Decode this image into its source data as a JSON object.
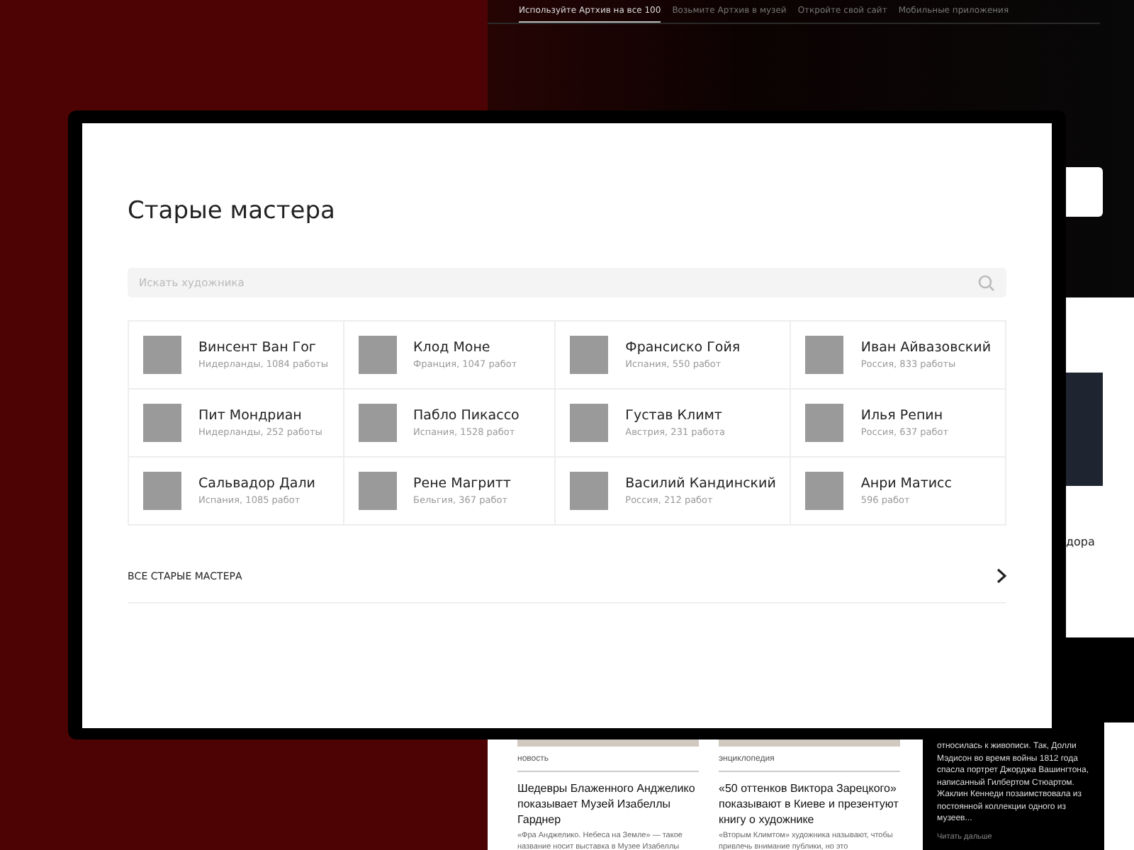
{
  "site_nav": {
    "tabs": [
      {
        "label": "Используйте Артхив на все 100",
        "selected": true
      },
      {
        "label": "Возьмите Артхив в музей",
        "selected": false
      },
      {
        "label": "Откройте свой сайт",
        "selected": false
      },
      {
        "label": "Мобильные приложения",
        "selected": false
      }
    ]
  },
  "side_fragment": "дора",
  "news": [
    {
      "category": "новость",
      "title": "Шедевры Блаженного Анджелико показывает Музей Изабеллы Гарднер",
      "excerpt": "«Фра Анджелико. Небеса на Земле» — такое название носит выставка в Музее Изабеллы"
    },
    {
      "category": "энциклопедия",
      "title": "«50 оттенков Виктора Зарецкого» показывают в Киеве и презентуют книгу о художнике",
      "excerpt": "«Вторым Климтом» художника называют, чтобы привлечь внимание публики, но это"
    }
  ],
  "story": {
    "text": "относилась к живописи. Так, Долли Мэдисон во время войны 1812 года спасла портрет Джорджа Вашингтона, написанный Гилбертом Стюартом. Жаклин Кеннеди позаимствовала из постоянной коллекции одного из музеев...",
    "link": "Читать дальше"
  },
  "dialog": {
    "title": "Старые мастера",
    "search": {
      "placeholder": "Искать художника"
    },
    "artists": [
      {
        "name": "Винсент Ван Гог",
        "info": "Нидерланды, 1084 работы"
      },
      {
        "name": "Клод Моне",
        "info": "Франция, 1047 работ"
      },
      {
        "name": "Франсиско Гойя",
        "info": "Испания, 550 работ"
      },
      {
        "name": "Иван Айвазовский",
        "info": "Россия, 833 работы"
      },
      {
        "name": "Пит Мондриан",
        "info": "Нидерланды, 252 работы"
      },
      {
        "name": "Пабло Пикассо",
        "info": "Испания, 1528 работ"
      },
      {
        "name": "Густав Климт",
        "info": "Австрия, 231 работа"
      },
      {
        "name": "Илья Репин",
        "info": "Россия, 637 работ"
      },
      {
        "name": "Сальвадор Дали",
        "info": "Испания, 1085 работ"
      },
      {
        "name": "Рене Магритт",
        "info": "Бельгия, 367 работ"
      },
      {
        "name": "Василий Кандинский",
        "info": "Россия, 212 работ"
      },
      {
        "name": "Анри Матисс",
        "info": "596 работ"
      }
    ],
    "all_link": "ВСЕ СТАРЫЕ МАСТЕРА"
  }
}
